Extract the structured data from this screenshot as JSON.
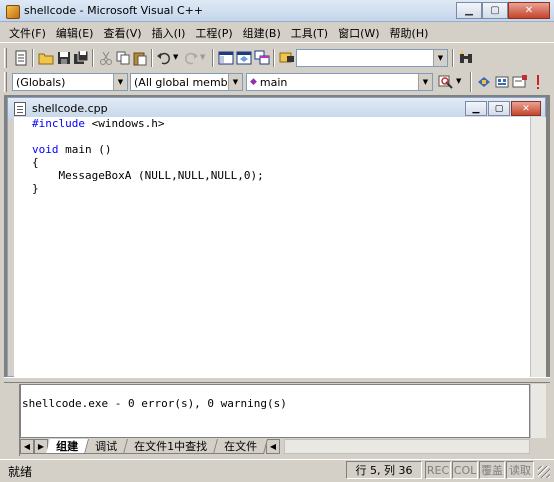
{
  "window": {
    "title": "shellcode - Microsoft Visual C++"
  },
  "menu": [
    {
      "label": "文件(F)"
    },
    {
      "label": "编辑(E)"
    },
    {
      "label": "查看(V)"
    },
    {
      "label": "插入(I)"
    },
    {
      "label": "工程(P)"
    },
    {
      "label": "组建(B)"
    },
    {
      "label": "工具(T)"
    },
    {
      "label": "窗口(W)"
    },
    {
      "label": "帮助(H)"
    }
  ],
  "toolbar": {
    "find_value": "",
    "scope_combo": "(Globals)",
    "members_combo": "(All global members",
    "function_combo": "main"
  },
  "document": {
    "title": "shellcode.cpp",
    "code": "#include <windows.h>\n\nvoid main ()\n{\n    MessageBoxA (NULL,NULL,NULL,0);\n}"
  },
  "output": {
    "text": "shellcode.exe - 0 error(s), 0 warning(s)",
    "tabs": [
      {
        "label": "组建"
      },
      {
        "label": "调试"
      },
      {
        "label": "在文件1中查找"
      },
      {
        "label": "在文件"
      }
    ]
  },
  "status": {
    "message": "就绪",
    "position": "行 5, 列 36",
    "rec": "REC",
    "col": "COL",
    "ovr": "覆盖",
    "read": "读取"
  },
  "colors": {
    "keyword": "#0000ff",
    "accent_title": "#c4d5ea"
  }
}
